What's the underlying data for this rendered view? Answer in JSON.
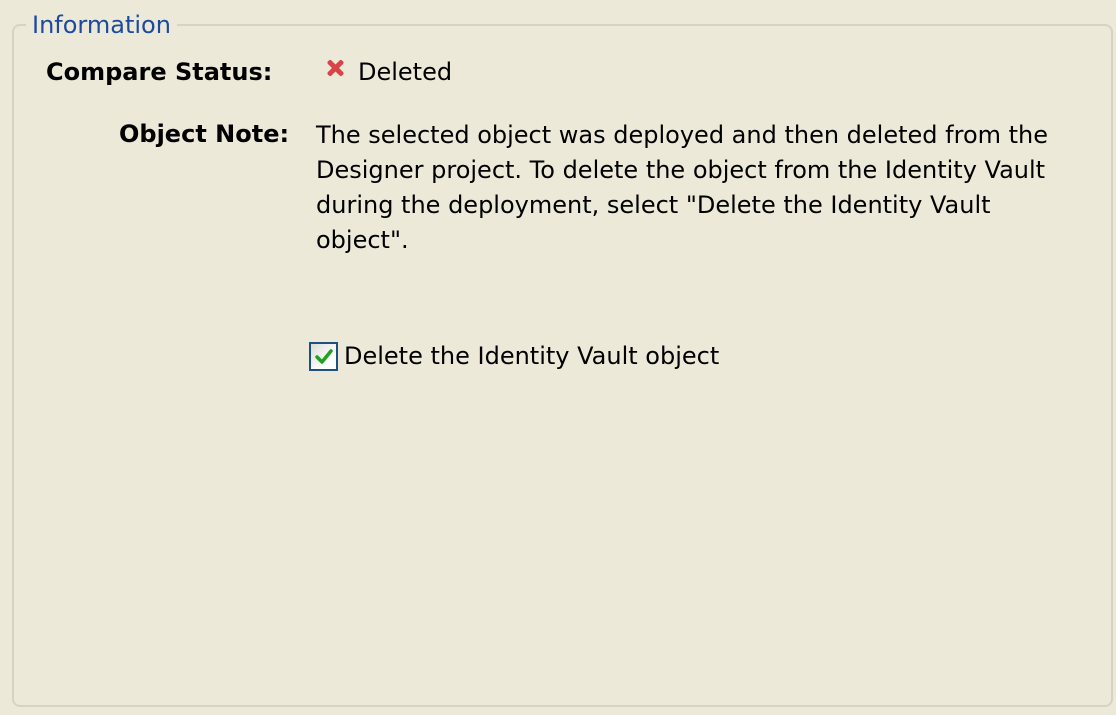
{
  "group": {
    "title": "Information"
  },
  "compare_status": {
    "label": "Compare Status:",
    "value": "Deleted",
    "icon": "red-x-icon",
    "icon_color": "#d9434a"
  },
  "object_note": {
    "label": "Object Note:",
    "text": "The selected object was deployed and then deleted from the Designer project. To delete the object from the Identity Vault during the deployment, select \"Delete the Identity Vault object\"."
  },
  "delete_option": {
    "label": "Delete the Identity Vault object",
    "checked": true,
    "check_color": "#21a121"
  },
  "colors": {
    "background": "#ece9d8",
    "group_title": "#1c4aa0",
    "group_border": "#d6d3c2"
  }
}
